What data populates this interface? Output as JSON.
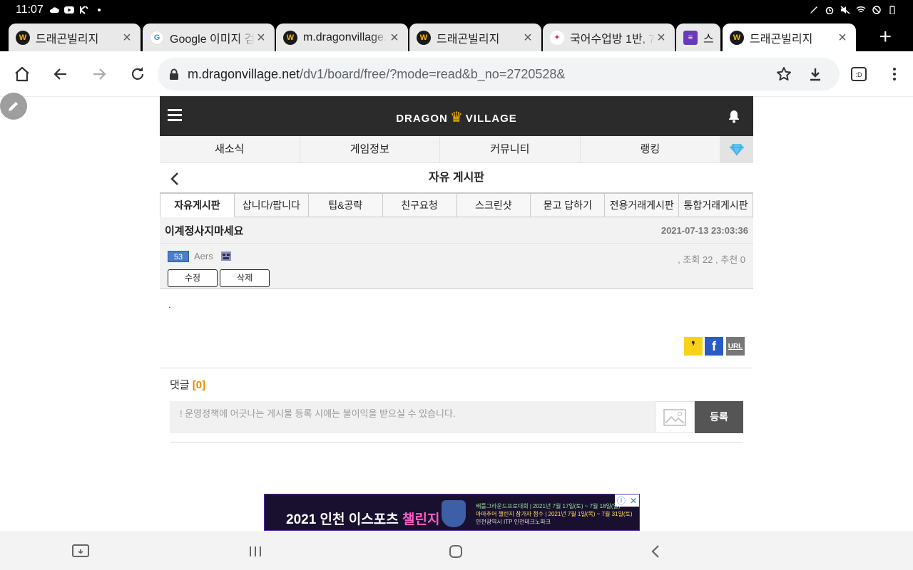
{
  "status_bar": {
    "time": "11:07",
    "left_icons": [
      "cloud-icon",
      "youtube-icon",
      "kiwi-icon",
      "dot-icon"
    ],
    "right_icons": [
      "pen-icon",
      "alarm-icon",
      "mute-icon",
      "wifi-icon",
      "dnd-icon",
      "battery-icon"
    ]
  },
  "tabs": [
    {
      "title": "드래곤빌리지",
      "favicon": "dragonvillage-favicon"
    },
    {
      "title": "Google 이미지 검",
      "favicon": "google-favicon"
    },
    {
      "title": "m.dragonvillage.",
      "favicon": "dragonvillage-favicon"
    },
    {
      "title": "드래곤빌리지",
      "favicon": "dragonvillage-favicon"
    },
    {
      "title": "국어수업방 1반, 7",
      "favicon": "bird-favicon"
    },
    {
      "title": "스",
      "favicon": "forms-favicon"
    },
    {
      "title": "드래곤빌리지",
      "favicon": "dragonvillage-favicon",
      "active": true
    }
  ],
  "address_bar": {
    "domain": "m.dragonvillage.net",
    "path": "/dv1/board/free/?mode=read&b_no=2720528&"
  },
  "site": {
    "logo_left": "DRAGON",
    "logo_right": "VILLAGE",
    "nav": [
      "새소식",
      "게임정보",
      "커뮤니티",
      "랭킹"
    ],
    "board_title": "자유 게시판",
    "sub_tabs": [
      "자유게시판",
      "삽니다/팝니다",
      "팁&공략",
      "친구요청",
      "스크린샷",
      "묻고 답하기",
      "전용거래게시판",
      "통합거래게시판"
    ]
  },
  "post": {
    "title": "이계정사지마세요",
    "date": "2021-07-13 23:03:36",
    "level": "53",
    "author": "Aers",
    "views_label": "조회 22",
    "likes_label": "추천 0",
    "edit_label": "수정",
    "delete_label": "삭제",
    "body": "."
  },
  "share": {
    "url_label": "URL"
  },
  "comments": {
    "title": "댓글",
    "count": "[0]",
    "placeholder": "! 운영정책에 어긋나는 게시물 등록 시에는 불이익을 받으실 수 있습니다.",
    "submit_label": "등록"
  },
  "ad": {
    "headline_prefix": "2021 인천 이스포츠 ",
    "headline_highlight": "챌린지",
    "line1": "배틀그라운드프로대회 | 2021년 7월 17일(토) ~ 7월 18일(일)",
    "line2": "아마추어 챌린지 참가자 접수 | 2021년 7월 1일(목) ~ 7월 31일(토)",
    "line3": "인천광역시   ITP 인천테크노파크"
  }
}
